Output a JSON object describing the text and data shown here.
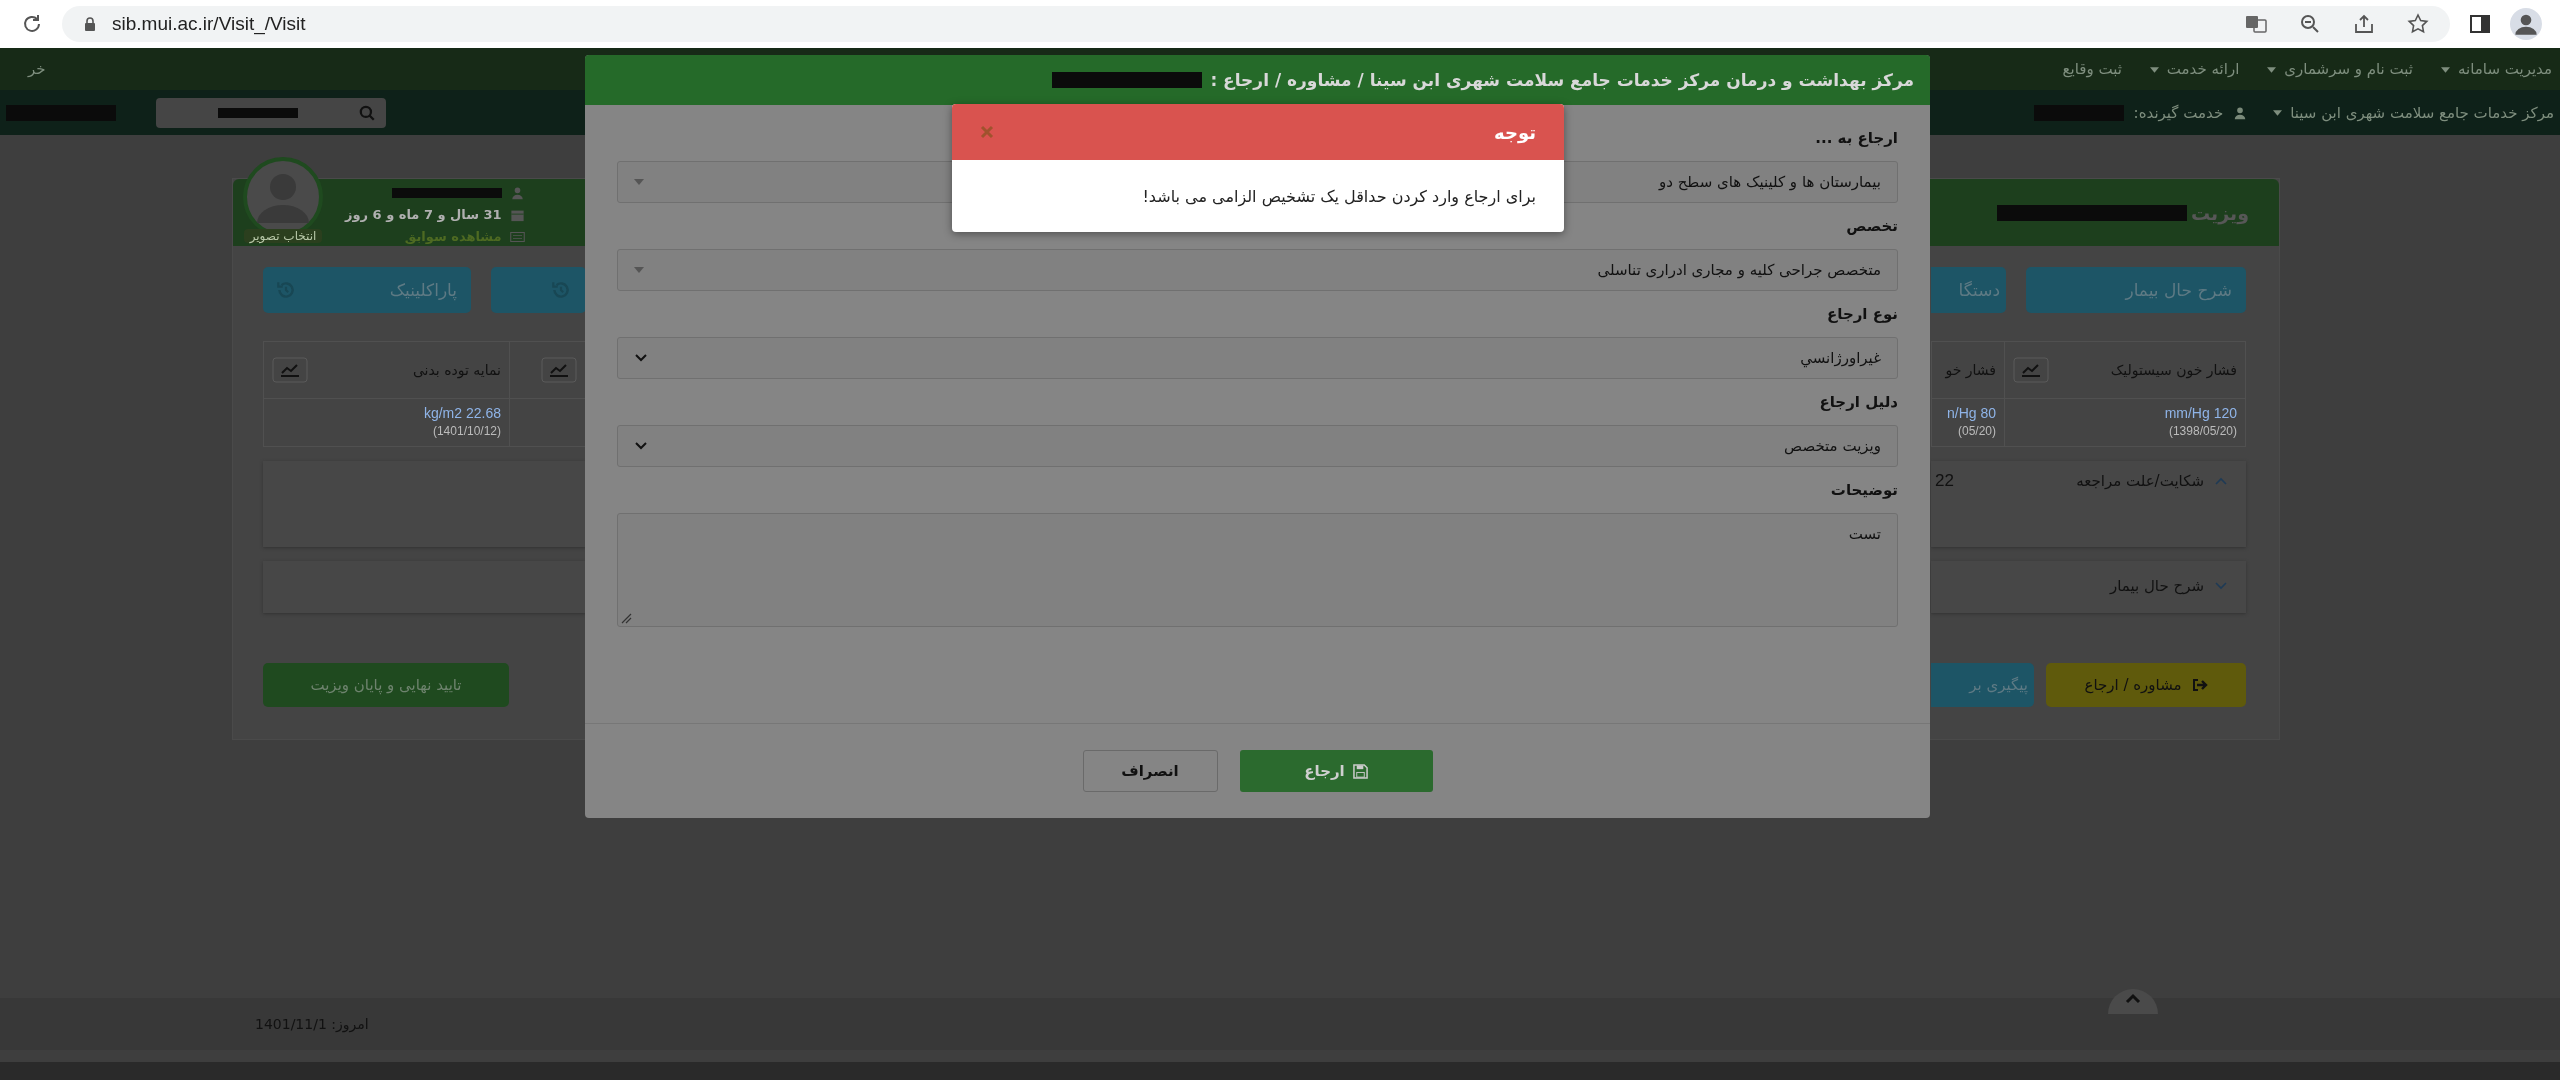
{
  "browser": {
    "url": "sib.mui.ac.ir/Visit_/Visit"
  },
  "top_menu": {
    "items": [
      {
        "label": "مدیریت سامانه",
        "dropdown": true
      },
      {
        "label": "ثبت نام و سرشماری",
        "dropdown": true
      },
      {
        "label": "ارائه خدمت",
        "dropdown": true
      },
      {
        "label": "ثبت وقایع",
        "dropdown": false
      }
    ],
    "logout": "خر"
  },
  "sub_bar": {
    "center": "مرکز خدمات جامع سلامت شهری ابن سینا",
    "client_label": "خدمت گیرنده:"
  },
  "visit": {
    "title": "ویزیت",
    "patient": {
      "age": "31 سال و 7 ماه و 6 روز",
      "history_link": "مشاهده سوابق",
      "photo_button": "انتخاب تصویر"
    },
    "tabs_right": [
      {
        "label": "شرح حال بیمار"
      },
      {
        "label": "دستگا"
      }
    ],
    "tabs_left": [
      {
        "label": "پاراکلینیک"
      }
    ],
    "vitals_right": [
      {
        "name": "فشار خون سیستولیک",
        "value": "mm/Hg 120",
        "date": "(1398/05/20)"
      },
      {
        "name": "فشار خو",
        "value": "n/Hg 80",
        "date": "(05/20)"
      }
    ],
    "vitals_left": [
      {
        "name": "نمایه توده بدنی",
        "value": "kg/m2 22.68",
        "date": "(1401/10/12)"
      }
    ],
    "accordions": [
      {
        "title": "شکایت/علت مراجعه",
        "expanded": true,
        "aside": "22"
      },
      {
        "title": "شرح حال بیمار",
        "expanded": false
      }
    ],
    "actions_right": [
      {
        "label": "مشاوره / ارجاع",
        "kind": "warning"
      },
      {
        "label": "پیگیری بر",
        "kind": "info"
      }
    ],
    "actions_left": [
      {
        "label": "تایید نهایی و پایان ویزیت",
        "kind": "success"
      }
    ]
  },
  "footer": {
    "today": "امروز: 1401/11/1"
  },
  "modal": {
    "title": "مرکز بهداشت و درمان مرکز خدمات جامع سلامت شهری ابن سینا / مشاوره / ارجاع :",
    "fields": [
      {
        "label": "ارجاع به ...",
        "value": "بیمارستان ها و کلینیک های سطح دو",
        "kind": "select"
      },
      {
        "label": "تخصص",
        "value": "متخصص جراحی کلیه و مجاری ادراری تناسلی",
        "kind": "select"
      },
      {
        "label": "نوع ارجاع",
        "value": "غیراورژانسي",
        "kind": "dropdown"
      },
      {
        "label": "دلیل ارجاع",
        "value": "ویزیت متخصص",
        "kind": "dropdown"
      },
      {
        "label": "توضیحات",
        "value": "تست",
        "kind": "textarea"
      }
    ],
    "buttons": [
      {
        "label": "ارجاع",
        "kind": "primary"
      },
      {
        "label": "انصراف",
        "kind": "default"
      }
    ]
  },
  "alert": {
    "title": "توجه",
    "message": "برای ارجاع وارد کردن حداقل یک تشخیص الزامی می باشد!"
  }
}
